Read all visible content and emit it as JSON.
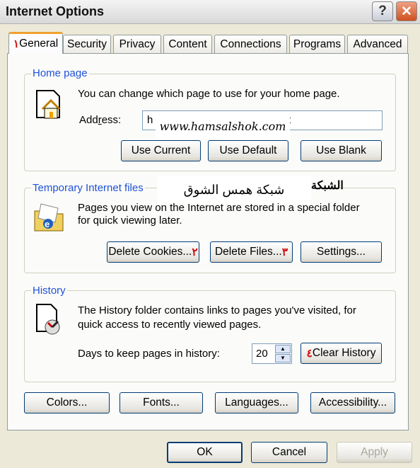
{
  "window": {
    "title": "Internet Options",
    "help_label": "?",
    "close_label": "✕"
  },
  "tabs": [
    {
      "label": "General",
      "active": true,
      "marker": "١"
    },
    {
      "label": "Security"
    },
    {
      "label": "Privacy"
    },
    {
      "label": "Content"
    },
    {
      "label": "Connections"
    },
    {
      "label": "Programs"
    },
    {
      "label": "Advanced"
    }
  ],
  "home": {
    "legend": "Home page",
    "description": "You can change which page to use for your home page.",
    "address_label": "Address:",
    "address_value": "h",
    "address_tail": "t",
    "watermark": "www.hamsalshok.com",
    "buttons": [
      "Use Current",
      "Use Default",
      "Use Blank"
    ]
  },
  "temp": {
    "legend": "Temporary Internet files",
    "watermark": "شبكة همس الشوق",
    "watermark_bold": "الشبكة",
    "line1": "Pages you view on the Internet are stored in a special folder",
    "line2": "for quick viewing later.",
    "buttons": [
      "Delete Cookies...",
      "Delete Files...",
      "Settings..."
    ],
    "markers": [
      "٢",
      "٣"
    ]
  },
  "history": {
    "legend": "History",
    "line1": "The History folder contains links to pages you've visited, for",
    "line2": "quick access to recently viewed pages.",
    "days_label": "Days to keep pages in history:",
    "days_value": "20",
    "clear_label": "Clear History",
    "marker": "٤"
  },
  "bottom_buttons": [
    "Colors...",
    "Fonts...",
    "Languages...",
    "Accessibility..."
  ],
  "dialog_buttons": {
    "ok": "OK",
    "cancel": "Cancel",
    "apply": "Apply"
  },
  "colors": {
    "accent": "#1f52d8",
    "marker": "#d01010"
  }
}
